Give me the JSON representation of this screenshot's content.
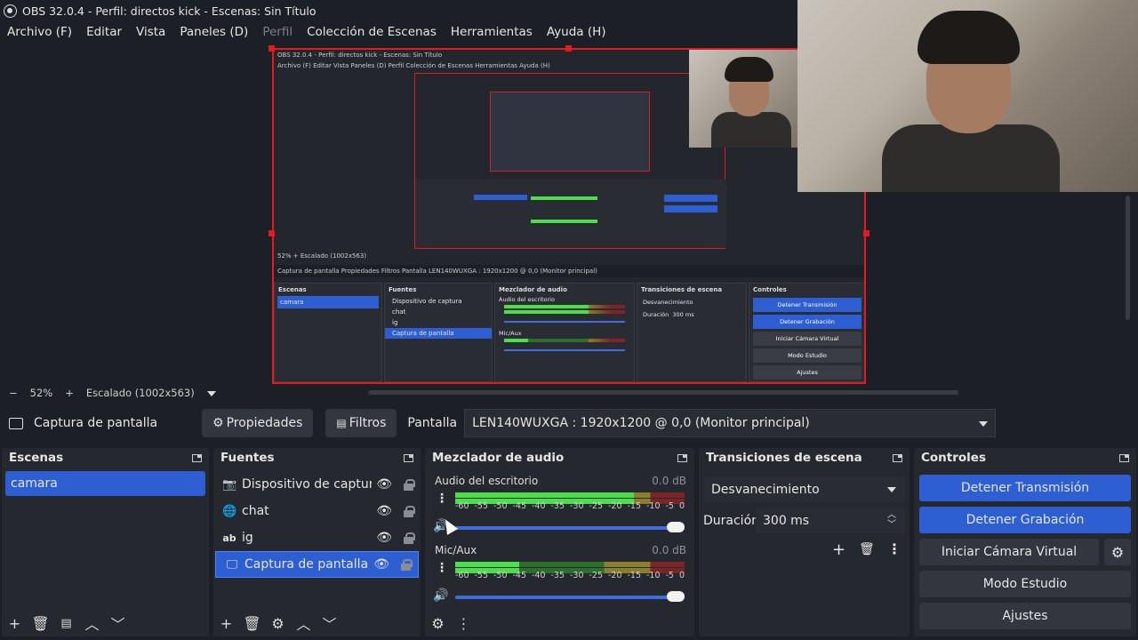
{
  "window": {
    "title": "OBS 32.0.4 - Perfil: directos kick - Escenas: Sin Título"
  },
  "menu": [
    "Archivo (F)",
    "Editar",
    "Vista",
    "Paneles (D)",
    "Perfil",
    "Colección de Escenas",
    "Herramientas",
    "Ayuda (H)"
  ],
  "preview_mini": {
    "title": "OBS 32.0.4 - Perfil: directos kick - Escenas: Sin Título",
    "menu": "Archivo (F)   Editar   Vista   Paneles (D)   Perfil   Colección de Escenas   Herramientas   Ayuda (H)",
    "zoom": "52%   +   Escalado (1002x563)",
    "source_bar": "Captura de pantalla     Propiedades     Filtros     Pantalla   LEN140WUXGA : 1920x1200 @ 0,0 (Monitor principal)",
    "scenes_hdr": "Escenas",
    "scene": "camara",
    "sources_hdr": "Fuentes",
    "sources": [
      "Dispositivo de captura",
      "chat",
      "ig",
      "Captura de pantalla"
    ],
    "mixer_hdr": "Mezclador de audio",
    "mixer1": "Audio del escritorio",
    "mixer2": "Mic/Aux",
    "db": "0.0 dB",
    "trans_hdr": "Transiciones de escena",
    "trans": "Desvanecimiento",
    "dur_label": "Duración",
    "dur": "300 ms",
    "ctrl_hdr": "Controles",
    "ctrl": [
      "Detener Transmisión",
      "Detener Grabación",
      "Iniciar Cámara Virtual",
      "Modo Estudio",
      "Ajustes"
    ]
  },
  "zoom": {
    "minus": "−",
    "value": "52%",
    "plus": "+",
    "scale": "Escalado (1002x563)"
  },
  "source_bar": {
    "selected": "Captura de pantalla",
    "properties": "Propiedades",
    "filters": "Filtros",
    "display_label": "Pantalla",
    "display_value": "LEN140WUXGA : 1920x1200 @ 0,0 (Monitor principal)"
  },
  "scenes": {
    "title": "Escenas",
    "items": [
      "camara"
    ]
  },
  "sources": {
    "title": "Fuentes",
    "items": [
      {
        "label": "Dispositivo de captura c",
        "icon": "camera-icon"
      },
      {
        "label": "chat",
        "icon": "browser-icon"
      },
      {
        "label": "ig",
        "icon": "text-icon"
      },
      {
        "label": "Captura de pantalla",
        "icon": "monitor-icon"
      }
    ]
  },
  "mixer": {
    "title": "Mezclador de audio",
    "tracks": [
      {
        "name": "Audio del escritorio",
        "db": "0.0 dB",
        "level": 0.78,
        "volume": 1.0
      },
      {
        "name": "Mic/Aux",
        "db": "0.0 dB",
        "level": 0.28,
        "volume": 1.0
      }
    ],
    "scale": [
      "-60",
      "-55",
      "-50",
      "-45",
      "-40",
      "-35",
      "-30",
      "-25",
      "-20",
      "-15",
      "-10",
      "-5",
      "0"
    ]
  },
  "transitions": {
    "title": "Transiciones de escena",
    "selected": "Desvanecimiento",
    "duration_label": "Duración",
    "duration": "300 ms"
  },
  "controls": {
    "title": "Controles",
    "stop_stream": "Detener Transmisión",
    "stop_record": "Detener Grabación",
    "virtual_cam": "Iniciar Cámara Virtual",
    "studio_mode": "Modo Estudio",
    "settings": "Ajustes"
  },
  "colors": {
    "accent": "#2d5fd3",
    "bg": "#1d1f26",
    "dock": "#26282f",
    "selection_border": "#e21b1b"
  }
}
